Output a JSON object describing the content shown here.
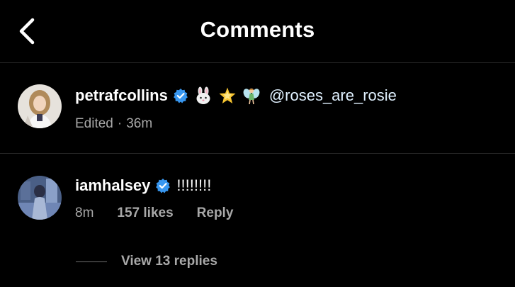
{
  "header": {
    "title": "Comments",
    "back_icon": "chevron-left-icon"
  },
  "comments": [
    {
      "username": "petrafcollins",
      "verified": true,
      "emojis": [
        "rabbit-face-emoji",
        "glowing-star-emoji",
        "fairy-emoji"
      ],
      "mention": "@roses_are_rosie",
      "meta": {
        "status": "Edited",
        "separator": "·",
        "time": "36m"
      }
    },
    {
      "username": "iamhalsey",
      "verified": true,
      "text": "!!!!!!!!",
      "meta": {
        "time": "8m",
        "likes": "157 likes",
        "reply": "Reply"
      },
      "view_replies": "View 13 replies"
    }
  ],
  "colors": {
    "background": "#000000",
    "primary_text": "#ffffff",
    "secondary_text": "#a8a8a8",
    "verified_badge": "#3897f0",
    "divider": "#262626"
  }
}
